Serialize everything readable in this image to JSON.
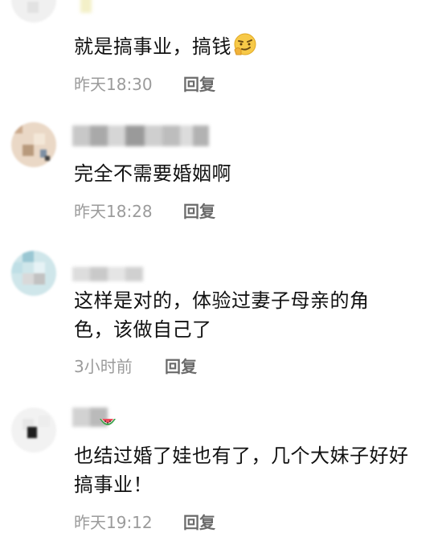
{
  "comments": [
    {
      "text": "就是搞事业，搞钱",
      "emoji": "smirk-face-emoji",
      "time": "昨天18:30",
      "reply": "回复"
    },
    {
      "text": "完全不需要婚姻啊",
      "time": "昨天18:28",
      "reply": "回复"
    },
    {
      "text": "这样是对的，体验过妻子母亲的角色，该做自己了",
      "time": "3小时前",
      "reply": "回复"
    },
    {
      "text": "也结过婚了娃也有了，几个大妹子好好搞事业！",
      "badge": "watermelon-icon",
      "time": "昨天19:12",
      "reply": "回复"
    }
  ],
  "colors": {
    "text": "#111111",
    "time": "#9b9b9b",
    "reply": "#6b6b6b"
  }
}
